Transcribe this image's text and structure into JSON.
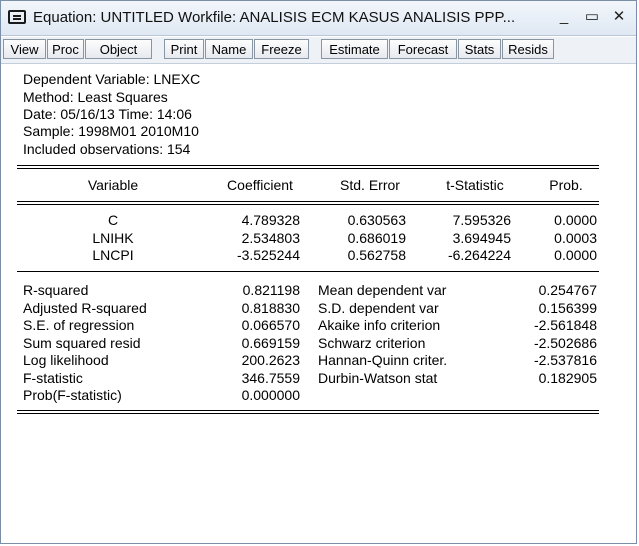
{
  "window": {
    "title": "Equation: UNTITLED   Workfile: ANALISIS ECM KASUS ANALISIS PPP...",
    "minimize": "_",
    "maximize": "▭",
    "close": "✕"
  },
  "toolbar": [
    "View",
    "Proc",
    "Object",
    "Print",
    "Name",
    "Freeze",
    "Estimate",
    "Forecast",
    "Stats",
    "Resids"
  ],
  "header": [
    "Dependent Variable: LNEXC",
    "Method: Least Squares",
    "Date: 05/16/13   Time: 14:06",
    "Sample: 1998M01 2010M10",
    "Included observations: 154"
  ],
  "table": {
    "columns": [
      "Variable",
      "Coefficient",
      "Std. Error",
      "t-Statistic",
      "Prob."
    ],
    "rows": [
      [
        "C",
        "4.789328",
        "0.630563",
        "7.595326",
        "0.0000"
      ],
      [
        "LNIHK",
        "2.534803",
        "0.686019",
        "3.694945",
        "0.0003"
      ],
      [
        "LNCPI",
        "-3.525244",
        "0.562758",
        "-6.264224",
        "0.0000"
      ]
    ]
  },
  "stats": [
    [
      "R-squared",
      "0.821198",
      "Mean dependent var",
      "0.254767"
    ],
    [
      "Adjusted R-squared",
      "0.818830",
      "S.D. dependent var",
      "0.156399"
    ],
    [
      "S.E. of regression",
      "0.066570",
      "Akaike info criterion",
      "-2.561848"
    ],
    [
      "Sum squared resid",
      "0.669159",
      "Schwarz criterion",
      "-2.502686"
    ],
    [
      "Log likelihood",
      "200.2623",
      "Hannan-Quinn criter.",
      "-2.537816"
    ],
    [
      "F-statistic",
      "346.7559",
      "Durbin-Watson stat",
      "0.182905"
    ],
    [
      "Prob(F-statistic)",
      "0.000000",
      "",
      ""
    ]
  ]
}
